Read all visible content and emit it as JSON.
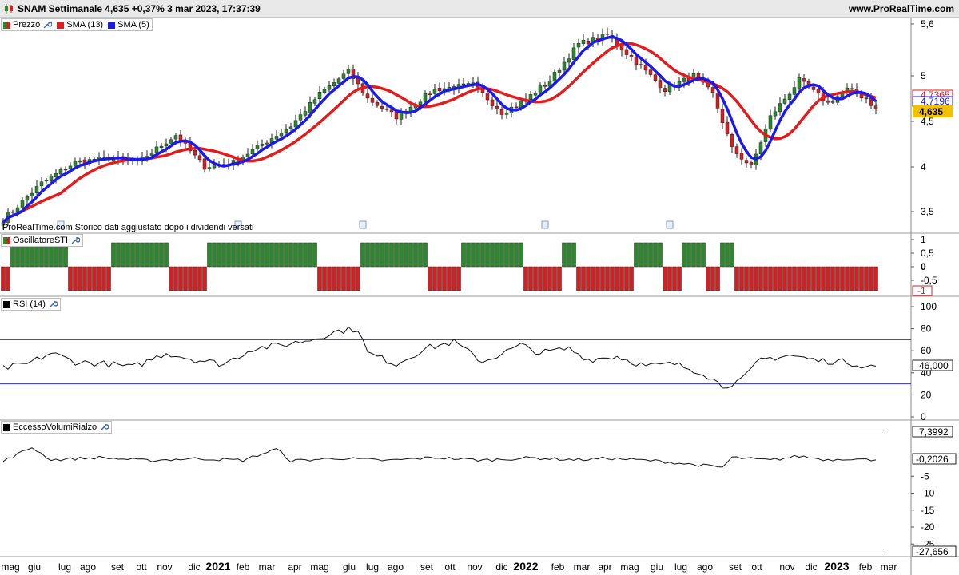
{
  "header": {
    "title": "SNAM Settimanale 4,635 +0,37% 3 mar 2023, 17:37:39",
    "site": "www.ProRealTime.com"
  },
  "legends": {
    "price": [
      {
        "label": "Prezzo",
        "color": "split"
      },
      {
        "label": "SMA (13)",
        "color": "#e31b1b"
      },
      {
        "label": "SMA (5)",
        "color": "#1a1aee"
      }
    ],
    "oscillator": "OscillatoreSTI",
    "rsi": "RSI (14)",
    "volume": "EccessoVolumiRialzo"
  },
  "note": "ProRealTime.com  Storico dati aggiustato dopo i dividendi versati",
  "colors": {
    "up": "#2a8a2a",
    "down": "#d42020",
    "sma13": "#e31b1b",
    "sma5": "#1a1aee",
    "rsi_band": "#2f2fb0",
    "price_tag": "#f2c200"
  },
  "axes": {
    "price_ticks": [
      "5,6",
      "5",
      "4,5",
      "4",
      "3,5"
    ],
    "price_badges": {
      "sma13": "4,7365",
      "sma5": "4,7196",
      "last": "4,635"
    },
    "osc_ticks": [
      "1",
      "0,5",
      "0",
      "-0,5"
    ],
    "osc_badge": "-1",
    "rsi_ticks": [
      "100",
      "80",
      "60",
      "40",
      "20",
      "0"
    ],
    "rsi_badge": "46,000",
    "vol_ticks": [
      "-5",
      "-10",
      "-15",
      "-20",
      "-25"
    ],
    "vol_badges": {
      "upper": "7,3992",
      "last": "-0,2026",
      "lower": "-27,656"
    },
    "x_labels": [
      "mag",
      "giu",
      "lug",
      "ago",
      "set",
      "ott",
      "nov",
      "dic",
      "2021",
      "feb",
      "mar",
      "apr",
      "mag",
      "giu",
      "lug",
      "ago",
      "set",
      "ott",
      "nov",
      "dic",
      "2022",
      "feb",
      "mar",
      "apr",
      "mag",
      "giu",
      "lug",
      "ago",
      "set",
      "ott",
      "nov",
      "dic",
      "2023",
      "feb",
      "mar"
    ]
  },
  "chart_data": [
    {
      "type": "candlestick",
      "title": "SNAM Settimanale",
      "series": [
        {
          "name": "Prezzo",
          "anchors": [
            [
              0,
              3.42
            ],
            [
              8,
              3.82
            ],
            [
              15,
              4.05
            ],
            [
              22,
              4.1
            ],
            [
              28,
              4.05
            ],
            [
              36,
              4.35
            ],
            [
              42,
              4.0
            ],
            [
              48,
              4.05
            ],
            [
              54,
              4.25
            ],
            [
              60,
              4.45
            ],
            [
              66,
              4.8
            ],
            [
              72,
              5.05
            ],
            [
              76,
              4.75
            ],
            [
              82,
              4.55
            ],
            [
              90,
              4.85
            ],
            [
              98,
              4.9
            ],
            [
              104,
              4.6
            ],
            [
              108,
              4.7
            ],
            [
              114,
              4.95
            ],
            [
              120,
              5.35
            ],
            [
              126,
              5.45
            ],
            [
              132,
              5.15
            ],
            [
              138,
              4.85
            ],
            [
              144,
              5.0
            ],
            [
              148,
              4.8
            ],
            [
              152,
              4.2
            ],
            [
              156,
              4.0
            ],
            [
              160,
              4.55
            ],
            [
              166,
              4.95
            ],
            [
              172,
              4.7
            ],
            [
              176,
              4.85
            ],
            [
              180,
              4.75
            ],
            [
              182,
              4.635
            ]
          ]
        },
        {
          "name": "SMA (13)",
          "last": 4.7365
        },
        {
          "name": "SMA (5)",
          "last": 4.7196
        }
      ],
      "ylim": [
        3.4,
        5.65
      ]
    },
    {
      "type": "bar",
      "title": "OscillatoreSTI",
      "segments": [
        [
          0,
          1,
          -1
        ],
        [
          2,
          13,
          1
        ],
        [
          14,
          22,
          -1
        ],
        [
          23,
          34,
          1
        ],
        [
          35,
          42,
          -1
        ],
        [
          43,
          65,
          1
        ],
        [
          66,
          74,
          -1
        ],
        [
          75,
          88,
          1
        ],
        [
          89,
          95,
          -1
        ],
        [
          96,
          108,
          1
        ],
        [
          109,
          116,
          -1
        ],
        [
          117,
          119,
          1
        ],
        [
          120,
          131,
          -1
        ],
        [
          132,
          137,
          1
        ],
        [
          138,
          141,
          -1
        ],
        [
          142,
          146,
          1
        ],
        [
          147,
          149,
          -1
        ],
        [
          150,
          152,
          1
        ],
        [
          153,
          182,
          -1
        ]
      ],
      "ylim": [
        -1,
        1
      ]
    },
    {
      "type": "line",
      "title": "RSI (14)",
      "series": [
        {
          "name": "RSI (14)",
          "anchors": [
            [
              0,
              44
            ],
            [
              5,
              48
            ],
            [
              10,
              58
            ],
            [
              15,
              50
            ],
            [
              22,
              48
            ],
            [
              27,
              45
            ],
            [
              34,
              58
            ],
            [
              40,
              52
            ],
            [
              46,
              48
            ],
            [
              52,
              62
            ],
            [
              58,
              65
            ],
            [
              64,
              70
            ],
            [
              70,
              78
            ],
            [
              74,
              80
            ],
            [
              76,
              58
            ],
            [
              82,
              48
            ],
            [
              88,
              62
            ],
            [
              94,
              68
            ],
            [
              100,
              50
            ],
            [
              108,
              65
            ],
            [
              112,
              58
            ],
            [
              118,
              62
            ],
            [
              122,
              52
            ],
            [
              128,
              55
            ],
            [
              134,
              46
            ],
            [
              140,
              48
            ],
            [
              146,
              40
            ],
            [
              150,
              28
            ],
            [
              154,
              33
            ],
            [
              158,
              52
            ],
            [
              164,
              56
            ],
            [
              170,
              51
            ],
            [
              176,
              50
            ],
            [
              180,
              46
            ]
          ]
        }
      ],
      "bands": [
        30,
        70
      ],
      "ylim": [
        0,
        100
      ]
    },
    {
      "type": "line",
      "title": "EccessoVolumiRialzo",
      "series": [
        {
          "name": "EccessoVolumiRialzo",
          "anchors": [
            [
              0,
              -0.6
            ],
            [
              6,
              3.5
            ],
            [
              10,
              -0.2
            ],
            [
              20,
              0.5
            ],
            [
              30,
              -0.4
            ],
            [
              40,
              0.2
            ],
            [
              50,
              -0.3
            ],
            [
              57,
              3.0
            ],
            [
              60,
              -0.5
            ],
            [
              70,
              0.3
            ],
            [
              80,
              -0.4
            ],
            [
              90,
              0.5
            ],
            [
              100,
              -0.3
            ],
            [
              110,
              0.4
            ],
            [
              120,
              -0.2
            ],
            [
              126,
              0.3
            ],
            [
              136,
              -0.5
            ],
            [
              150,
              -2.4
            ],
            [
              152,
              0.5
            ],
            [
              160,
              -0.3
            ],
            [
              166,
              0.9
            ],
            [
              172,
              -0.2
            ],
            [
              176,
              0.2
            ],
            [
              180,
              -0.2
            ]
          ]
        }
      ],
      "levels": {
        "upper": 7.3992,
        "lower": -27.656,
        "last": -0.2026
      },
      "ylim": [
        -29,
        11
      ]
    }
  ]
}
